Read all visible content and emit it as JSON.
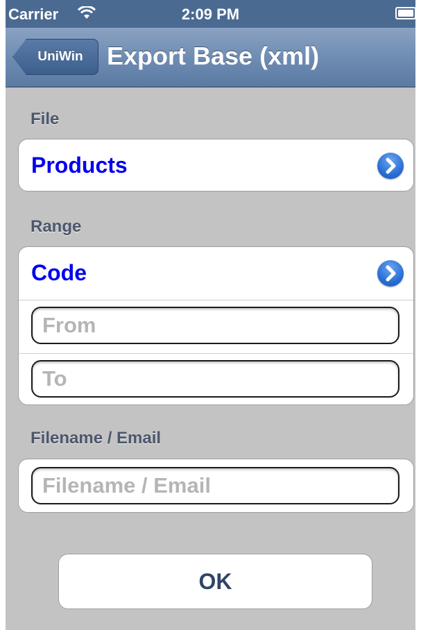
{
  "status_bar": {
    "carrier": "Carrier",
    "time": "2:09 PM",
    "wifi_icon": "wifi-icon",
    "battery_icon": "battery-icon"
  },
  "nav": {
    "back_label": "UniWin",
    "title": "Export Base (xml)"
  },
  "file_section": {
    "header": "File",
    "value": "Products",
    "disclosure_icon": "disclosure-chevron-icon"
  },
  "range_section": {
    "header": "Range",
    "field": "Code",
    "from_placeholder": "From",
    "to_placeholder": "To"
  },
  "filename_section": {
    "header": "Filename / Email",
    "placeholder": "Filename / Email"
  },
  "ok_label": "OK",
  "colors": {
    "status_bar": "#4b6a92",
    "nav_bar": "#6f8db3",
    "background": "#c3c3c3",
    "value_text": "#0000ee",
    "disclosure": "#2a6fd6"
  }
}
